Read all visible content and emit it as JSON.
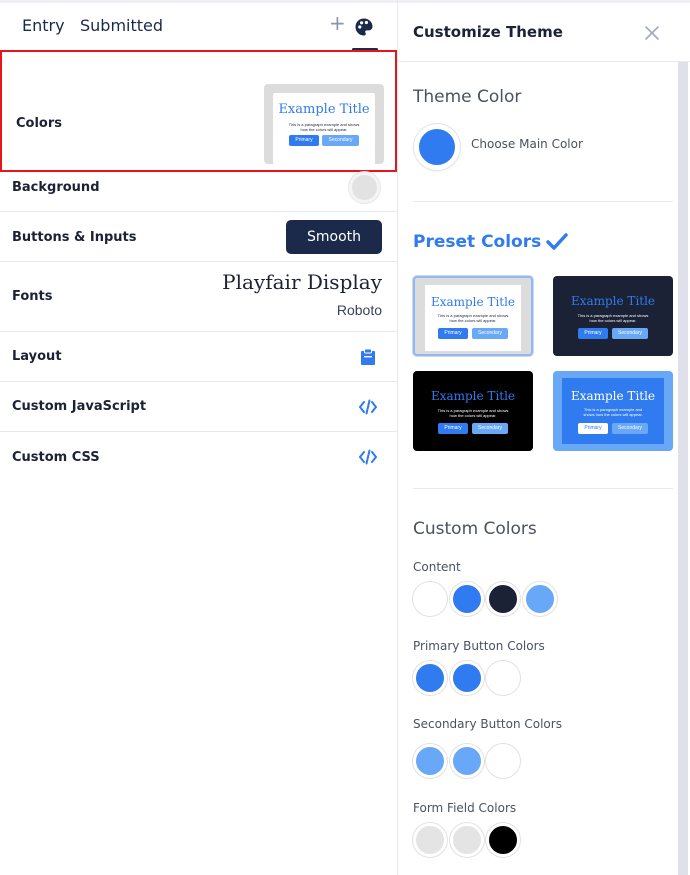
{
  "tabs": {
    "entry": "Entry",
    "submitted": "Submitted",
    "plus": "+"
  },
  "left": {
    "colors_label": "Colors",
    "background_label": "Background",
    "buttons_label": "Buttons & Inputs",
    "buttons_value": "Smooth",
    "fonts_label": "Fonts",
    "font_primary": "Playfair Display",
    "font_secondary": "Roboto",
    "layout_label": "Layout",
    "js_label": "Custom JavaScript",
    "css_label": "Custom CSS",
    "background_color": "#e2e2e2"
  },
  "preview": {
    "title": "Example Title",
    "text": "This is a paragraph example and shows how the colors will appear.",
    "primary": "Primary",
    "secondary": "Secondary"
  },
  "right": {
    "title": "Customize Theme",
    "theme_color_title": "Theme Color",
    "choose_label": "Choose Main Color",
    "main_color": "#2f7bef",
    "preset_title": "Preset Colors",
    "custom_title": "Custom Colors",
    "groups": {
      "content": "Content",
      "primary": "Primary Button Colors",
      "secondary": "Secondary Button Colors",
      "form": "Form Field Colors"
    }
  },
  "colors": {
    "accent": "#2f7bef",
    "navy": "#1b2a4a",
    "light_blue": "#69a8f7",
    "content_swatches": [
      "#ffffff",
      "#2f7bef",
      "#1b2236",
      "#69a8f7"
    ],
    "primary_swatches": [
      "#2f7bef",
      "#2f7bef",
      "#ffffff"
    ],
    "secondary_swatches": [
      "#69a8f7",
      "#69a8f7",
      "#ffffff"
    ],
    "form_swatches": [
      "#e4e4e4",
      "#e4e4e4",
      "#000000"
    ]
  },
  "presets": [
    {
      "name": "light",
      "outer": "#dcdcdc",
      "card": "#ffffff",
      "title": "#2f7bef",
      "text": "#1b2236",
      "primary_bg": "#2f7bef",
      "primary_fg": "#ffffff",
      "secondary_bg": "#69a8f7",
      "secondary_fg": "#ffffff",
      "selected": true
    },
    {
      "name": "navy",
      "outer": "#1b2236",
      "card": "#1b2236",
      "title": "#2f7bef",
      "text": "#ffffff",
      "primary_bg": "#2f7bef",
      "primary_fg": "#ffffff",
      "secondary_bg": "#69a8f7",
      "secondary_fg": "#ffffff",
      "selected": false
    },
    {
      "name": "black",
      "outer": "#000000",
      "card": "#000000",
      "title": "#2f7bef",
      "text": "#ffffff",
      "primary_bg": "#2f7bef",
      "primary_fg": "#ffffff",
      "secondary_bg": "#69a8f7",
      "secondary_fg": "#ffffff",
      "selected": false
    },
    {
      "name": "blue",
      "outer": "#69a8f7",
      "card": "#2f7bef",
      "title": "#ffffff",
      "text": "#ffffff",
      "primary_bg": "#ffffff",
      "primary_fg": "#2f7bef",
      "secondary_bg": "#69a8f7",
      "secondary_fg": "#ffffff",
      "selected": false
    }
  ],
  "icons": {
    "plus": "plus-icon",
    "palette": "palette-icon",
    "layout": "clipboard-icon",
    "code": "code-icon",
    "close": "close-icon",
    "check": "check-icon"
  }
}
